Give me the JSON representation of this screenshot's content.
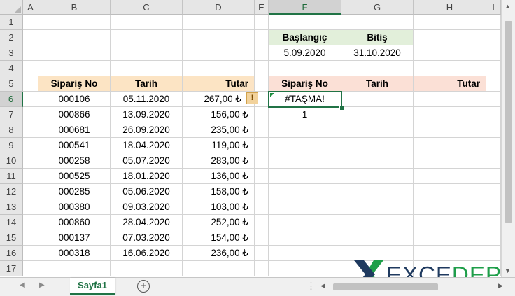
{
  "columns": [
    "A",
    "B",
    "C",
    "D",
    "E",
    "F",
    "G",
    "H",
    "I"
  ],
  "rows": [
    "1",
    "2",
    "3",
    "4",
    "5",
    "6",
    "7",
    "8",
    "9",
    "10",
    "11",
    "12",
    "13",
    "14",
    "15",
    "16",
    "17"
  ],
  "criteria": {
    "start_header": "Başlangıç",
    "end_header": "Bitiş",
    "start_value": "5.09.2020",
    "end_value": "31.10.2020"
  },
  "source_table": {
    "headers": [
      "Sipariş No",
      "Tarih",
      "Tutar"
    ],
    "rows": [
      [
        "000106",
        "05.11.2020",
        "267,00 ₺"
      ],
      [
        "000866",
        "13.09.2020",
        "156,00 ₺"
      ],
      [
        "000681",
        "26.09.2020",
        "235,00 ₺"
      ],
      [
        "000541",
        "18.04.2020",
        "119,00 ₺"
      ],
      [
        "000258",
        "05.07.2020",
        "283,00 ₺"
      ],
      [
        "000525",
        "18.01.2020",
        "136,00 ₺"
      ],
      [
        "000285",
        "05.06.2020",
        "158,00 ₺"
      ],
      [
        "000380",
        "09.03.2020",
        "103,00 ₺"
      ],
      [
        "000860",
        "28.04.2020",
        "252,00 ₺"
      ],
      [
        "000137",
        "07.03.2020",
        "154,00 ₺"
      ],
      [
        "000318",
        "16.06.2020",
        "236,00 ₺"
      ]
    ]
  },
  "result_table": {
    "headers": [
      "Sipariş No",
      "Tarih",
      "Tutar"
    ],
    "f6": "#TAŞMA!",
    "f7": "1"
  },
  "warning_icon": "!",
  "sheet_tab": "Sayfa1",
  "add_sheet": "+",
  "scroll_dots": "⋮",
  "watermark": {
    "mark": "X",
    "left_text": "EXCEL",
    "right_text": "DEPO"
  },
  "colors": {
    "header_orange": "#fce4c4",
    "header_green": "#e2efda",
    "header_pink": "#fbe0d6",
    "excel_green": "#217346"
  }
}
